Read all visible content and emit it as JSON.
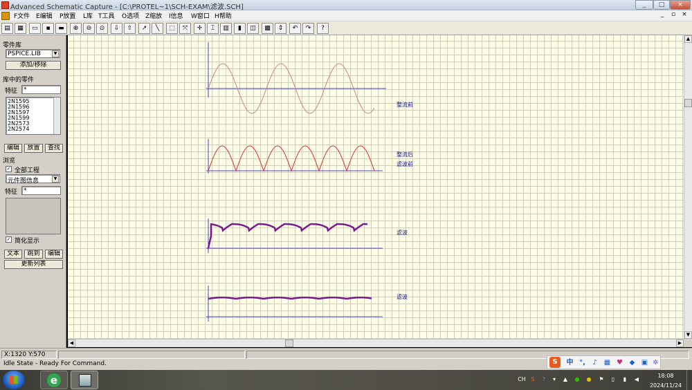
{
  "window": {
    "title": "Advanced Schematic Capture - [C:\\PROTEL~1\\SCH-EXAM\\滤波.SCH]",
    "minimize": "_",
    "restore": "□",
    "close": "×",
    "inner_minimize": "_",
    "inner_restore": "▫",
    "inner_close": "×"
  },
  "menu": [
    "F文件",
    "E编辑",
    "P放置",
    "L库",
    "T工具",
    "O选项",
    "Z缩放",
    "I信息",
    "W窗口",
    "H帮助"
  ],
  "toolbar": {
    "help_label": "?"
  },
  "library_panel": {
    "header": "零件库",
    "selected_library": "PSPICE.LIB",
    "add_remove_label": "添加/移除",
    "parts_header": "库中的零件",
    "filter_label": "特征",
    "filter_value": "*",
    "parts": [
      "2N1595",
      "2N1596",
      "2N1597",
      "2N1599",
      "2N2573",
      "2N2574"
    ],
    "edit_label": "编辑",
    "place_label": "放置",
    "find_label": "查找"
  },
  "browse_panel": {
    "header": "浏览",
    "all_projects_label": "全部工程",
    "all_projects_checked": true,
    "browse_type": "元件图信息",
    "filter_label": "特征",
    "filter_value": "*",
    "simplify_label": "简化显示",
    "simplify_checked": true,
    "text_label": "文本",
    "jump_label": "跳到",
    "edit_label": "编辑",
    "refresh_label": "更新列表"
  },
  "canvas": {
    "labels": [
      "整流前",
      "整流后",
      "滤波前",
      "滤波",
      "滤波"
    ],
    "colors": {
      "grid": "#cfcfbf",
      "axis": "#4040c0",
      "sine": "#d08080",
      "rectified": "#e03030",
      "filtered": "#7a1a8c",
      "label": "#1a1a80"
    }
  },
  "status": {
    "coords": "X:1320 Y:570",
    "message": "Idle State - Ready For Command."
  },
  "ime": {
    "logo": "S",
    "mode": "中"
  },
  "taskbar": {
    "lang": "CH",
    "time": "18:08",
    "date": "2024/11/24"
  }
}
